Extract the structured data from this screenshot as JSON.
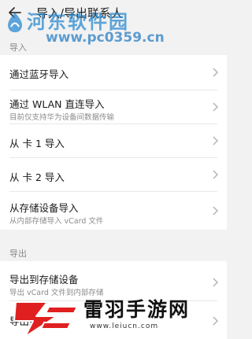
{
  "header": {
    "title": "导入/导出联系人"
  },
  "sections": {
    "import_label": "导入",
    "export_label": "导出"
  },
  "import_items": [
    {
      "label": "通过蓝牙导入",
      "sub": ""
    },
    {
      "label": "通过 WLAN 直连导入",
      "sub": "目前仅支持华为设备间数据传输"
    },
    {
      "label": "从 卡 1 导入",
      "sub": ""
    },
    {
      "label": "从 卡 2 导入",
      "sub": ""
    },
    {
      "label": "从存储设备导入",
      "sub": "从内部存储导入 vCard 文件"
    }
  ],
  "export_items": [
    {
      "label": "导出到存储设备",
      "sub": "导出 vCard 文件到内部存储"
    },
    {
      "label": "导出到…",
      "sub": ""
    }
  ],
  "watermarks": {
    "top_title": "河东软件园",
    "top_url": "www.pc0359.cn",
    "bottom_title": "雷羽手游网",
    "bottom_url": "www.leiucn.com"
  },
  "colors": {
    "background": "#f2f2f2",
    "card": "#ffffff",
    "watermark_blue": "#2a8ad0",
    "watermark_red": "#e02020"
  }
}
